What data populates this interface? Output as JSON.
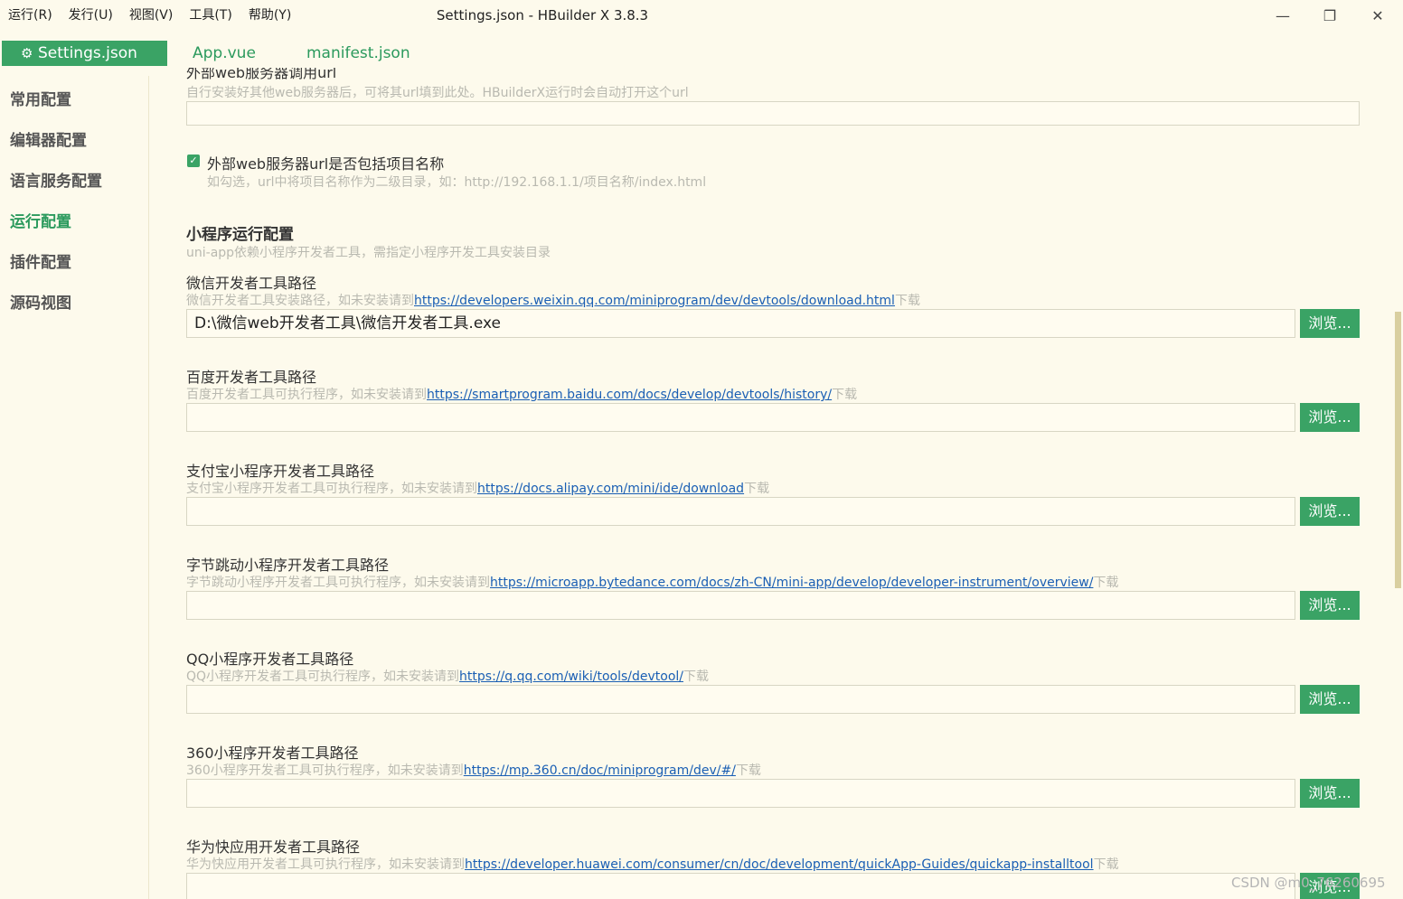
{
  "menu": [
    "运行(R)",
    "发行(U)",
    "视图(V)",
    "工具(T)",
    "帮助(Y)"
  ],
  "window": {
    "title": "Settings.json - HBuilder X 3.8.3",
    "minimize": "—",
    "maximize": "❐",
    "close": "✕"
  },
  "tabs": [
    {
      "label": "Settings.json",
      "icon": "gear-icon"
    },
    {
      "label": "App.vue"
    },
    {
      "label": "manifest.json"
    }
  ],
  "sidebar": [
    "常用配置",
    "编辑器配置",
    "语言服务配置",
    "运行配置",
    "插件配置",
    "源码视图"
  ],
  "sidebar_active": "运行配置",
  "top_section": {
    "clipped_label": "外部web服务器调用url",
    "desc": "自行安装好其他web服务器后，可将其url填到此处。HBuilderX运行时会自动打开这个url",
    "value": ""
  },
  "checkbox": {
    "label": "外部web服务器url是否包括项目名称",
    "desc": "如勾选，url中将项目名称作为二级目录，如：http://192.168.1.1/项目名称/index.html",
    "checked": true
  },
  "mini_section": {
    "title": "小程序运行配置",
    "desc": "uni-app依赖小程序开发者工具，需指定小程序开发工具安装目录"
  },
  "browse_label": "浏览...",
  "download_suffix": "下载",
  "tools": [
    {
      "label": "微信开发者工具路径",
      "desc": "微信开发者工具安装路径，如未安装请到",
      "url": "https://developers.weixin.qq.com/miniprogram/dev/devtools/download.html",
      "value": "D:\\微信web开发者工具\\微信开发者工具.exe"
    },
    {
      "label": "百度开发者工具路径",
      "desc": "百度开发者工具可执行程序，如未安装请到",
      "url": "https://smartprogram.baidu.com/docs/develop/devtools/history/",
      "value": ""
    },
    {
      "label": "支付宝小程序开发者工具路径",
      "desc": "支付宝小程序开发者工具可执行程序，如未安装请到",
      "url": "https://docs.alipay.com/mini/ide/download",
      "value": ""
    },
    {
      "label": "字节跳动小程序开发者工具路径",
      "desc": "字节跳动小程序开发者工具可执行程序，如未安装请到",
      "url": "https://microapp.bytedance.com/docs/zh-CN/mini-app/develop/developer-instrument/overview/",
      "value": ""
    },
    {
      "label": "QQ小程序开发者工具路径",
      "desc": "QQ小程序开发者工具可执行程序，如未安装请到",
      "url": "https://q.qq.com/wiki/tools/devtool/",
      "value": ""
    },
    {
      "label": "360小程序开发者工具路径",
      "desc": "360小程序开发者工具可执行程序，如未安装请到",
      "url": "https://mp.360.cn/doc/miniprogram/dev/#/",
      "value": ""
    },
    {
      "label": "华为快应用开发者工具路径",
      "desc": "华为快应用开发者工具可执行程序，如未安装请到",
      "url": "https://developer.huawei.com/consumer/cn/doc/development/quickApp-Guides/quickapp-installtool",
      "value": ""
    }
  ],
  "watermark": "CSDN @m0_76260695",
  "colors": {
    "accent": "#3aa365",
    "background": "#fdfaec",
    "link": "#1a5fb4"
  }
}
